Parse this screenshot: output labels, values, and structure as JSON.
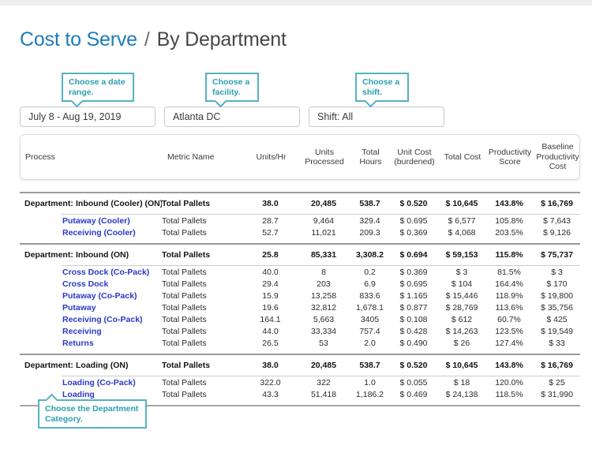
{
  "title": {
    "link": "Cost to Serve",
    "separator": "/",
    "current": "By Department"
  },
  "callouts": {
    "date_range": "Choose a date range.",
    "facility": "Choose a facility.",
    "shift": "Choose a shift.",
    "department": "Choose the Department Category."
  },
  "filters": {
    "date_range": {
      "value": "July 8 - Aug 19, 2019"
    },
    "facility": {
      "value": "Atlanta DC"
    },
    "shift": {
      "value": "Shift: All"
    }
  },
  "colors": {
    "title_blue": "#1c7cba",
    "process_link_blue": "#2839c7",
    "callout_teal": "#54b2c1",
    "separator_gray": "#9b9b9b"
  },
  "table": {
    "department_label": "Department:",
    "columns": [
      "Process",
      "Metric Name",
      "Units/Hr",
      "Units Processed",
      "Total Hours",
      "Unit Cost (burdened)",
      "Total Cost",
      "Productivity Score",
      "Baseline Productivity Cost"
    ],
    "groups": [
      {
        "name": "Inbound (Cooler) (ON)",
        "metric": "Total Pallets",
        "values": [
          "38.0",
          "20,485",
          "538.7",
          "$ 0.520",
          "$ 10,645",
          "143.8%",
          "$ 16,769"
        ],
        "rows": [
          {
            "process": "Putaway (Cooler)",
            "metric": "Total Pallets",
            "values": [
              "28.7",
              "9,464",
              "329.4",
              "$ 0.695",
              "$ 6,577",
              "105.8%",
              "$ 7,643"
            ]
          },
          {
            "process": "Receiving (Cooler)",
            "metric": "Total Pallets",
            "values": [
              "52.7",
              "11,021",
              "209.3",
              "$ 0.369",
              "$ 4,068",
              "203.5%",
              "$ 9,126"
            ]
          }
        ]
      },
      {
        "name": "Inbound (ON)",
        "metric": "Total Pallets",
        "values": [
          "25.8",
          "85,331",
          "3,308.2",
          "$ 0.694",
          "$ 59,153",
          "115.8%",
          "$ 75,737"
        ],
        "rows": [
          {
            "process": "Cross Dock (Co-Pack)",
            "metric": "Total Pallets",
            "values": [
              "40.0",
              "8",
              "0.2",
              "$ 0.369",
              "$ 3",
              "81.5%",
              "$ 3"
            ]
          },
          {
            "process": "Cross Dock",
            "metric": "Total Pallets",
            "values": [
              "29.4",
              "203",
              "6.9",
              "$ 0.695",
              "$ 104",
              "164.4%",
              "$ 170"
            ]
          },
          {
            "process": "Putaway (Co-Pack)",
            "metric": "Total Pallets",
            "values": [
              "15.9",
              "13,258",
              "833.6",
              "$ 1.165",
              "$ 15,446",
              "118.9%",
              "$ 19,800"
            ]
          },
          {
            "process": "Putaway",
            "metric": "Total Pallets",
            "values": [
              "19.6",
              "32,812",
              "1,678.1",
              "$ 0.877",
              "$ 28,769",
              "113.6%",
              "$ 35,756"
            ]
          },
          {
            "process": "Receiving (Co-Pack)",
            "metric": "Total Pallets",
            "values": [
              "164.1",
              "5,663",
              "3405",
              "$ 0.108",
              "$ 612",
              "60.7%",
              "$ 425"
            ]
          },
          {
            "process": "Receiving",
            "metric": "Total Pallets",
            "values": [
              "44.0",
              "33,334",
              "757.4",
              "$ 0.428",
              "$ 14,263",
              "123.5%",
              "$ 19,549"
            ]
          },
          {
            "process": "Returns",
            "metric": "Total Pallets",
            "values": [
              "26.5",
              "53",
              "2.0",
              "$ 0.490",
              "$ 26",
              "127.4%",
              "$ 33"
            ]
          }
        ]
      },
      {
        "name": "Loading (ON)",
        "metric": "Total Pallets",
        "values": [
          "38.0",
          "20,485",
          "538.7",
          "$ 0.520",
          "$ 10,645",
          "143.8%",
          "$ 16,769"
        ],
        "rows": [
          {
            "process": "Loading (Co-Pack)",
            "metric": "Total Pallets",
            "values": [
              "322.0",
              "322",
              "1.0",
              "$ 0.055",
              "$ 18",
              "120.0%",
              "$ 25"
            ]
          },
          {
            "process": "Loading",
            "metric": "Total Pallets",
            "values": [
              "43.3",
              "51,418",
              "1,186.2",
              "$ 0.469",
              "$ 24,138",
              "118.5%",
              "$ 31,990"
            ]
          }
        ]
      }
    ]
  }
}
